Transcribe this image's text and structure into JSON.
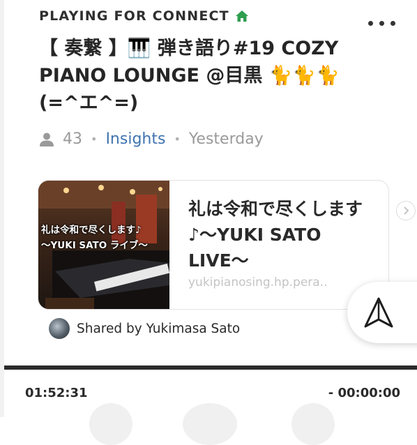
{
  "header": {
    "label": "PLAYING FOR CONNECT",
    "home_icon": "home-icon",
    "more_icon": "more-horizontal-icon",
    "home_color": "#2e9e4f"
  },
  "post": {
    "title": "【 奏繋 】🎹 弾き語り#19 COZY PIANO LOUNGE @目黒 🐈🐈🐈(=^エ^=)",
    "listeners": "43",
    "insights_label": "Insights",
    "time": "Yesterday",
    "accent": "#3f74b0"
  },
  "link_card": {
    "thumb_text_line1": "礼は令和で尽くします♪",
    "thumb_text_line2": "〜YUKI SATO ライブ〜",
    "title": "礼は令和で尽くします♪〜YUKI SATO LIVE〜",
    "url": "yukipianosing.hp.pera.."
  },
  "shared": {
    "label": "Shared by Yukimasa Sato"
  },
  "player": {
    "elapsed": "01:52:31",
    "remaining": "- 00:00:00",
    "progress": 1.0
  }
}
